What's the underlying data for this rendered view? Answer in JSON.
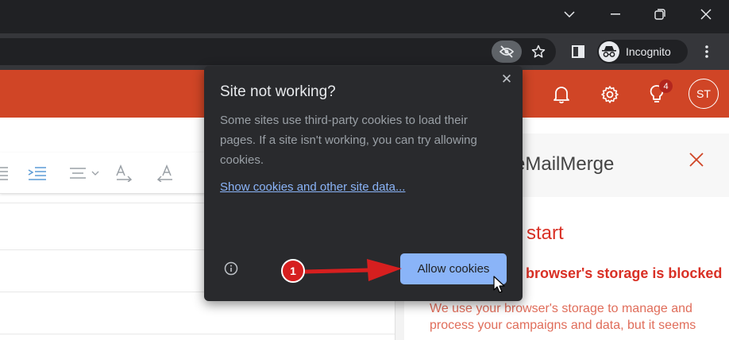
{
  "titlebar": {
    "controls": [
      "chevron-down-icon",
      "minimize-icon",
      "restore-icon",
      "close-icon"
    ]
  },
  "toolbar": {
    "profile_label": "Incognito"
  },
  "appbar": {
    "notification_count": "4",
    "avatar_initials": "ST",
    "color": "#d04526"
  },
  "sidepanel": {
    "title": "eMailMerge",
    "heading": "start",
    "warning": "browser's storage is blocked",
    "description": "We use your browser's storage to manage and process your campaigns and data, but it seems"
  },
  "popup": {
    "title": "Site not working?",
    "body": "Some sites use third-party cookies to load their pages. If a site isn't working, you can try allowing cookies.",
    "link": "Show cookies and other site data...",
    "close_symbol": "✕",
    "button_label": "Allow cookies"
  },
  "annotation": {
    "step": "1",
    "color": "#d61f1f"
  }
}
